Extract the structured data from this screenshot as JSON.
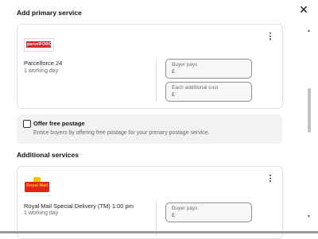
{
  "dialog": {
    "close_icon": "close-icon",
    "close_glyph": "✕"
  },
  "primary": {
    "heading": "Add primary service",
    "logo_text": "parcelFORCE",
    "service_name": "Parcelforce 24",
    "service_sub": "1 working day",
    "more_glyph": "⋮",
    "buyer_pays_label": "Buyer pays",
    "buyer_pays_currency": "£",
    "each_additional_label": "Each additional cost",
    "each_additional_currency": "£"
  },
  "offer": {
    "title": "Offer free postage",
    "subtitle": "Entice buyers by offering free postage for your primary postage service.",
    "checked": false
  },
  "additional": {
    "heading": "Additional services",
    "logo_text": "Royal Mail",
    "service_name": "Royal Mail Special Delivery (TM) 1:00 pm",
    "service_sub": "1 working day",
    "more_glyph": "⋮",
    "buyer_pays_label": "Buyer pays",
    "buyer_pays_currency": "£"
  },
  "scrollbar": {
    "up_glyph": "▲",
    "down_glyph": "▼"
  },
  "colors": {
    "parcelforce_red": "#d9232d",
    "royal_mail_red": "#e2231a",
    "royal_mail_yellow": "#f4c30e"
  }
}
